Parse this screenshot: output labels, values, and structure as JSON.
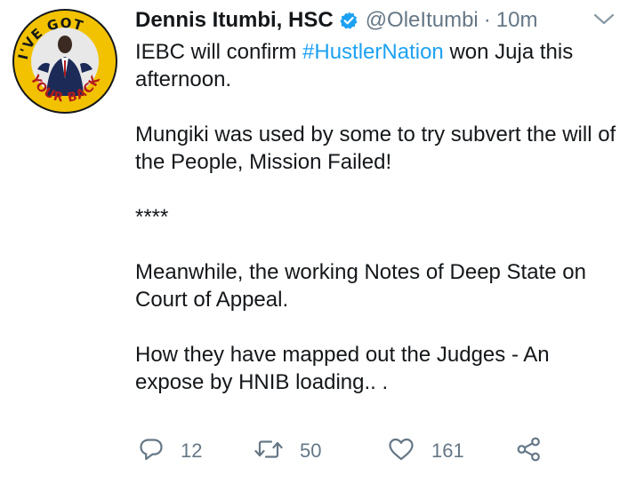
{
  "tweet": {
    "author": {
      "name": "Dennis Itumbi, HSC",
      "handle": "@OleItumbi",
      "verified": true,
      "avatar_icon": "campaign-badge-avatar",
      "avatar_text": "I'VE GOT YOUR BACK"
    },
    "separator": "·",
    "time": "10m",
    "text": {
      "line1_pre": "IEBC will confirm ",
      "hashtag": "#HustlerNation",
      "line1_post": " won Juja this afternoon.",
      "para2": "Mungiki was used by some to try subvert the will of the People, Mission Failed!",
      "para3": "****",
      "para4": "Meanwhile, the working Notes of Deep State on Court of Appeal.",
      "para5": "How they have mapped out the Judges - An expose by HNIB loading.. ."
    },
    "actions": {
      "replies": "12",
      "retweets": "50",
      "likes": "161"
    },
    "icons": {
      "verified": "verified-badge-icon",
      "caret": "chevron-down-icon",
      "reply": "reply-icon",
      "retweet": "retweet-icon",
      "like": "heart-icon",
      "share": "share-icon"
    },
    "colors": {
      "text": "#14171a",
      "secondary": "#657786",
      "link": "#1da1f2",
      "verified": "#1da1f2"
    }
  }
}
